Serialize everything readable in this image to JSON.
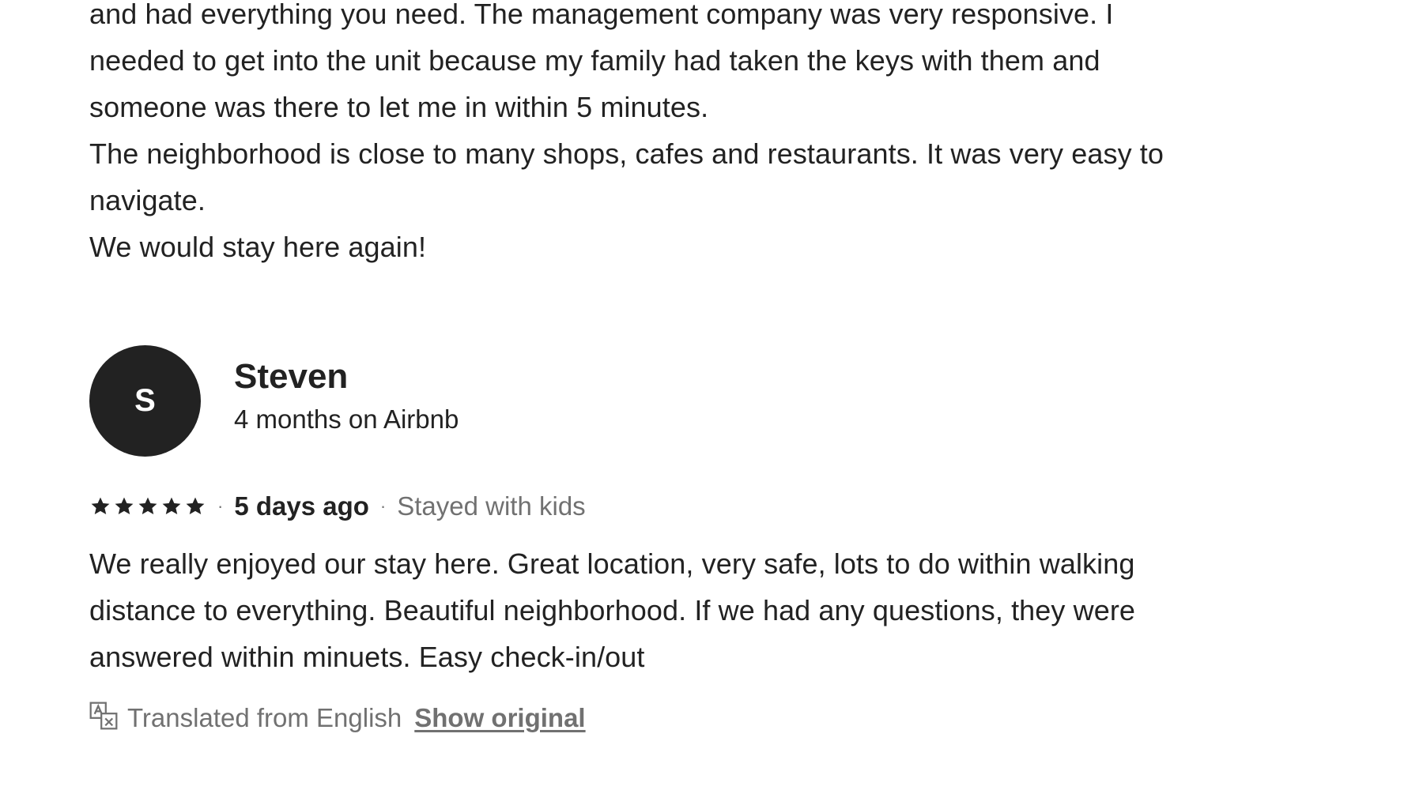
{
  "previous_review": {
    "lines": [
      "and had everything you need. The management company was very responsive. I",
      "needed to get into the unit because my family had taken the keys with them and",
      "someone was there to let me in within 5 minutes.",
      "The neighborhood is close to many shops, cafes and restaurants. It was very easy to",
      "navigate.",
      "We would stay here again!"
    ]
  },
  "review": {
    "avatar_initial": "S",
    "reviewer_name": "Steven",
    "reviewer_tenure": "4 months on Airbnb",
    "rating": 5,
    "separator": "·",
    "date": "5 days ago",
    "trip_type": "Stayed with kids",
    "body_lines": [
      "We really enjoyed our stay here. Great location, very safe, lots to do within walking",
      "distance to everything. Beautiful neighborhood. If we had any questions, they were",
      "answered within minuets. Easy check-in/out"
    ],
    "translation_note": "Translated from English",
    "show_original_label": "Show original"
  },
  "icons": {
    "star": "star-icon",
    "translate": "translate-icon"
  },
  "colors": {
    "text_primary": "#222222",
    "text_secondary": "#717171",
    "avatar_bg": "#222222",
    "background": "#ffffff"
  }
}
